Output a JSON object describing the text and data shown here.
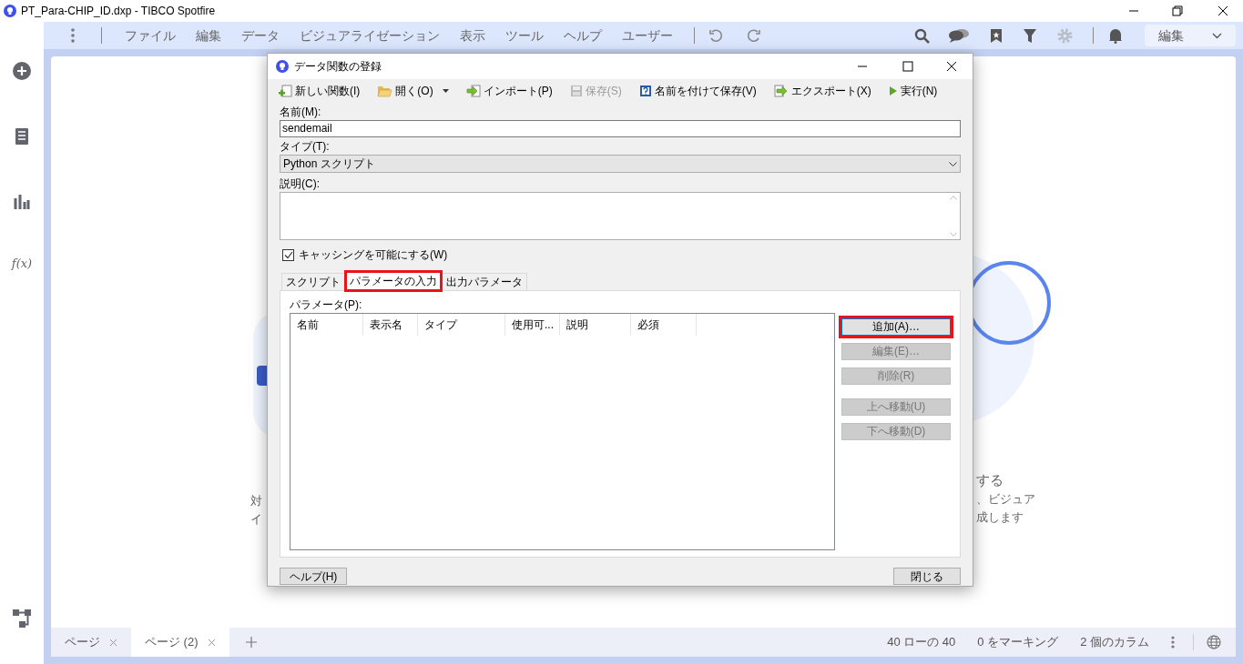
{
  "app_title": "PT_Para-CHIP_ID.dxp - TIBCO Spotfire",
  "function_rail_label": "f(x)",
  "menu": [
    "ファイル",
    "編集",
    "データ",
    "ビジュアライゼーション",
    "表示",
    "ツール",
    "ヘルプ",
    "ユーザー"
  ],
  "mode_select": "編集",
  "canvas_text": {
    "left": [
      "対",
      "イ"
    ],
    "right": [
      "する",
      "、ビジュア",
      "成します"
    ]
  },
  "dialog": {
    "title": "データ関数の登録",
    "toolbar": [
      {
        "kind": "new",
        "label": "新しい関数(I)",
        "disabled": false
      },
      {
        "kind": "open",
        "label": "開く(O)",
        "disabled": false
      },
      {
        "kind": "import",
        "label": "インポート(P)",
        "disabled": false
      },
      {
        "kind": "save",
        "label": "保存(S)",
        "disabled": true
      },
      {
        "kind": "save_as",
        "label": "名前を付けて保存(V)",
        "disabled": false
      },
      {
        "kind": "export",
        "label": "エクスポート(X)",
        "disabled": false
      },
      {
        "kind": "run",
        "label": "実行(N)",
        "disabled": false
      }
    ],
    "name_label": "名前(M):",
    "name_value": "sendemail",
    "type_label": "タイプ(T):",
    "type_value": "Python スクリプト",
    "description_label": "説明(C):",
    "caching": {
      "label": "キャッシングを可能にする(W)",
      "checked": true
    },
    "tabs": [
      {
        "label": "スクリプト",
        "selected": false,
        "highlighted": false
      },
      {
        "label": "パラメータの入力",
        "selected": true,
        "highlighted": true
      },
      {
        "label": "出力パラメータ",
        "selected": false,
        "highlighted": false
      }
    ],
    "parameters_label": "パラメータ(P):",
    "columns": [
      "名前",
      "表示名",
      "タイプ",
      "使用可...",
      "説明",
      "必須"
    ],
    "buttons": [
      {
        "label": "追加(A)…",
        "disabled": false,
        "highlighted": true
      },
      {
        "label": "編集(E)…",
        "disabled": true,
        "highlighted": false
      },
      {
        "label": "削除(R)",
        "disabled": true,
        "highlighted": false
      },
      {
        "label": "上へ移動(U)",
        "disabled": true,
        "highlighted": false
      },
      {
        "label": "下へ移動(D)",
        "disabled": true,
        "highlighted": false
      }
    ],
    "help_button": "ヘルプ(H)",
    "close_button": "閉じる"
  },
  "page_tabs": [
    {
      "label": "ページ",
      "selected": false
    },
    {
      "label": "ページ (2)",
      "selected": true
    }
  ],
  "status": [
    "40 ローの 40",
    "0 をマーキング",
    "2 個のカラム"
  ]
}
